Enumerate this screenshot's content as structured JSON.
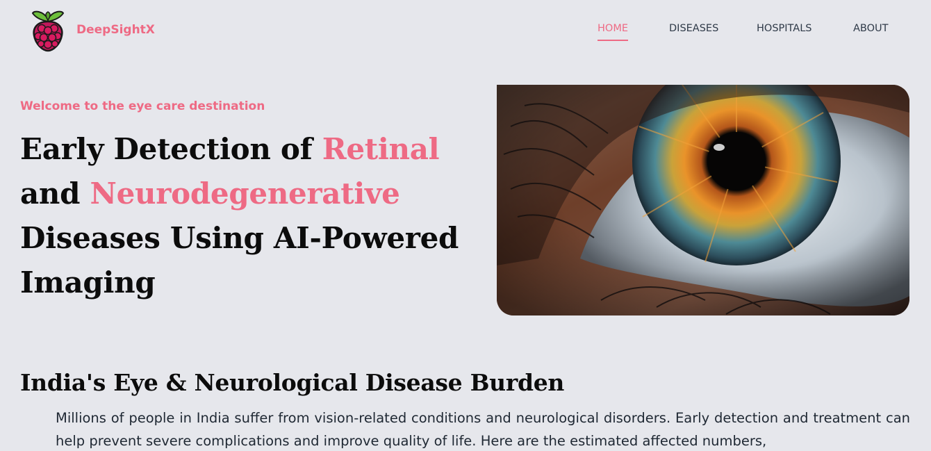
{
  "header": {
    "brand": "DeepSightX",
    "logo_icon": "raspberry-logo-icon",
    "nav": [
      {
        "label": "HOME",
        "active": true
      },
      {
        "label": "DISEASES",
        "active": false
      },
      {
        "label": "HOSPITALS",
        "active": false
      },
      {
        "label": "ABOUT",
        "active": false
      }
    ]
  },
  "hero": {
    "welcome": "Welcome to the eye care destination",
    "title_part1": "Early Detection of ",
    "title_accent1": "Retinal",
    "title_part2": " and ",
    "title_accent2": "Neurodegenerative",
    "title_part3": " Diseases Using AI-Powered Imaging",
    "image_icon": "eye-closeup-image"
  },
  "burden": {
    "title": "India's Eye & Neurological Disease Burden",
    "body": "Millions of people in India suffer from vision-related conditions and neurological disorders. Early detection and treatment can help prevent severe complications and improve quality of life. Here are the estimated affected numbers,"
  },
  "colors": {
    "accent": "#ee6a84",
    "background": "#e6e7ec",
    "nav_text": "#2f3a48"
  }
}
